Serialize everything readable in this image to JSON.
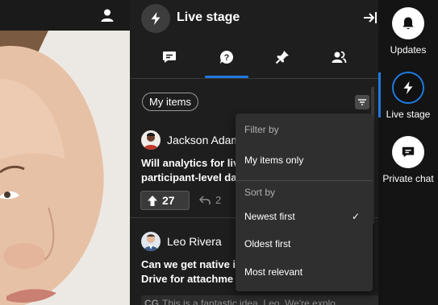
{
  "stage": {
    "title": "Live stage",
    "tabs": [
      {
        "name": "chat-tab"
      },
      {
        "name": "qa-tab",
        "active": true
      },
      {
        "name": "pinned-tab"
      },
      {
        "name": "people-tab"
      }
    ],
    "filter_chip": "My items",
    "questions": [
      {
        "author": "Jackson Adam",
        "text_line1": "Will analytics for liv",
        "text_line2": "participant-level da",
        "upvotes": "27",
        "replies": "2"
      },
      {
        "author": "Leo Rivera",
        "text_line1": "Can we get native i",
        "text_line2": "Drive for attachme",
        "answer_initials": "CG",
        "answer_preview": "This is a fantastic idea, Leo. We're explo"
      }
    ]
  },
  "dropdown": {
    "filter_heading": "Filter by",
    "filter_option": "My items only",
    "sort_heading": "Sort by",
    "sort_options": [
      {
        "label": "Newest first",
        "selected": true
      },
      {
        "label": "Oldest first",
        "selected": false
      },
      {
        "label": "Most relevant",
        "selected": false
      }
    ],
    "check_mark": "✓"
  },
  "rail": {
    "items": [
      {
        "label": "Updates",
        "icon": "bell-icon"
      },
      {
        "label": "Live stage",
        "icon": "bolt-icon",
        "active": true
      },
      {
        "label": "Private chat",
        "icon": "chat-bubble-icon"
      }
    ]
  },
  "colors": {
    "accent": "#1f7ae0",
    "panel_bg": "#1e1e1e",
    "rail_bg": "#141414",
    "dropdown_bg": "#2f2f2f"
  }
}
